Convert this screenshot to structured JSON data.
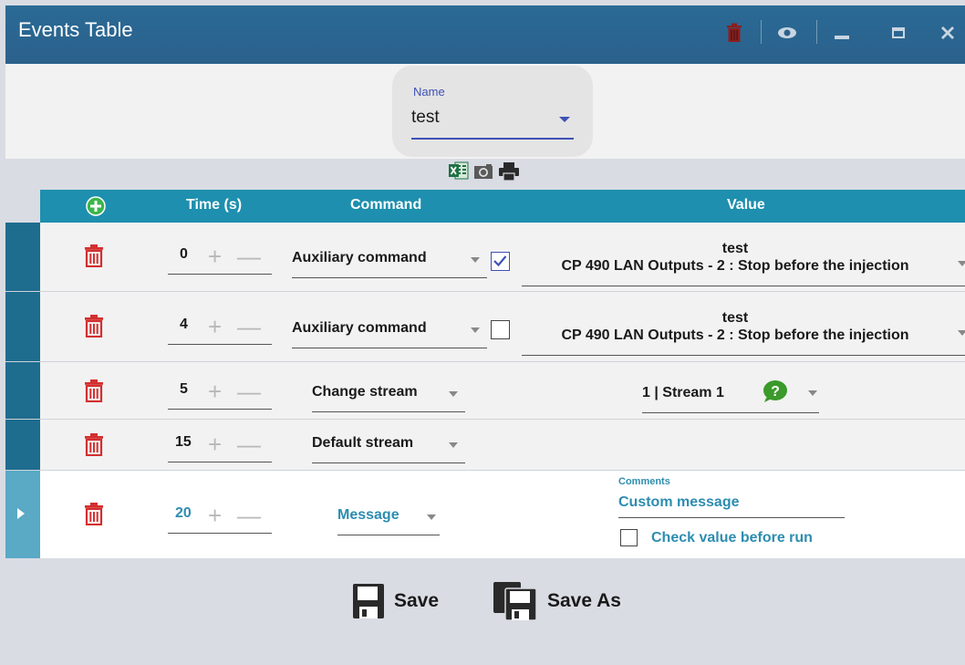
{
  "window": {
    "title": "Events Table"
  },
  "name_field": {
    "label": "Name",
    "value": "test"
  },
  "table": {
    "headers": {
      "time": "Time (s)",
      "command": "Command",
      "value": "Value"
    },
    "rows": [
      {
        "time": "0",
        "command": "Auxiliary command",
        "checked": true,
        "value_line1": "test",
        "value_line2": "CP 490 LAN Outputs - 2 : Stop before the injection"
      },
      {
        "time": "4",
        "command": "Auxiliary command",
        "checked": false,
        "value_line1": "test",
        "value_line2": "CP 490 LAN Outputs - 2 : Stop before the injection"
      },
      {
        "time": "5",
        "command": "Change stream",
        "value": "1 | Stream 1"
      },
      {
        "time": "15",
        "command": "Default stream"
      },
      {
        "time": "20",
        "command": "Message",
        "comments_label": "Comments",
        "comment_value": "Custom message",
        "check_label": "Check value before run",
        "checked": false
      }
    ]
  },
  "footer": {
    "save_label": "Save",
    "save_as_label": "Save As"
  },
  "colors": {
    "titlebar": "#2b618c",
    "header": "#1e8fae",
    "accent": "#3f51b5",
    "teal_text": "#2d8db0",
    "trash": "#d32f2f"
  }
}
